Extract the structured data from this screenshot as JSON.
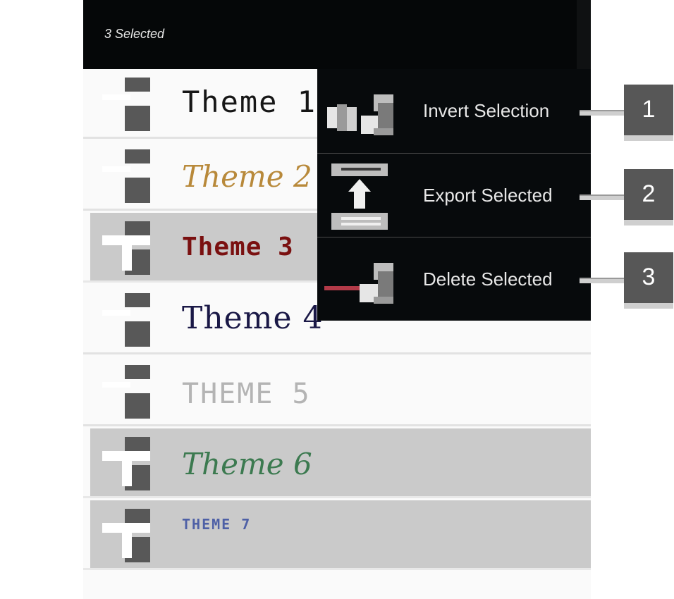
{
  "toolbar": {
    "selection_count_label": "3 Selected"
  },
  "themes": [
    {
      "label": "Theme 1",
      "selected": false
    },
    {
      "label": "Theme 2",
      "selected": false
    },
    {
      "label": "Theme 3",
      "selected": true
    },
    {
      "label": "Theme 4",
      "selected": false
    },
    {
      "label": "THEME 5",
      "selected": false
    },
    {
      "label": "Theme 6",
      "selected": true
    },
    {
      "label": "THEME 7",
      "selected": true
    }
  ],
  "menu": {
    "items": [
      {
        "label": "Invert Selection",
        "icon": "invert-selection-icon"
      },
      {
        "label": "Export Selected",
        "icon": "export-icon"
      },
      {
        "label": "Delete Selected",
        "icon": "delete-icon"
      }
    ]
  },
  "callouts": [
    "1",
    "2",
    "3"
  ],
  "colors": {
    "toolbar_bg": "#050708",
    "menu_bg": "#070a0c",
    "selected_row": "#cacaca",
    "callout_box": "#575757"
  }
}
